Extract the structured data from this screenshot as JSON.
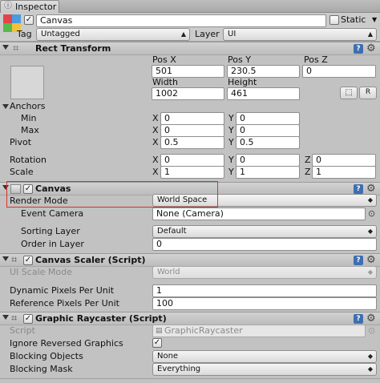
{
  "tab": {
    "label": "Inspector"
  },
  "object": {
    "name": "Canvas",
    "static_label": "Static",
    "tag_label": "Tag",
    "tag_value": "Untagged",
    "layer_label": "Layer",
    "layer_value": "UI"
  },
  "rect_transform": {
    "title": "Rect Transform",
    "pos_x_label": "Pos X",
    "pos_y_label": "Pos Y",
    "pos_z_label": "Pos Z",
    "pos_x": "501",
    "pos_y": "230.5",
    "pos_z": "0",
    "width_label": "Width",
    "height_label": "Height",
    "width": "1002",
    "height": "461",
    "r_label": "R",
    "anchors_label": "Anchors",
    "min_label": "Min",
    "max_label": "Max",
    "anchor_min_x": "0",
    "anchor_min_y": "0",
    "anchor_max_x": "0",
    "anchor_max_y": "0",
    "pivot_label": "Pivot",
    "pivot_x": "0.5",
    "pivot_y": "0.5",
    "rotation_label": "Rotation",
    "rot_x": "0",
    "rot_y": "0",
    "rot_z": "0",
    "scale_label": "Scale",
    "scale_x": "1",
    "scale_y": "1",
    "scale_z": "1",
    "x": "X",
    "y": "Y",
    "z": "Z"
  },
  "canvas": {
    "title": "Canvas",
    "render_mode_label": "Render Mode",
    "render_mode": "World Space",
    "event_camera_label": "Event Camera",
    "event_camera": "None (Camera)",
    "sorting_layer_label": "Sorting Layer",
    "sorting_layer": "Default",
    "order_label": "Order in Layer",
    "order": "0"
  },
  "canvas_scaler": {
    "title": "Canvas Scaler (Script)",
    "ui_scale_label": "UI Scale Mode",
    "ui_scale": "World",
    "dynamic_label": "Dynamic Pixels Per Unit",
    "dynamic": "1",
    "reference_label": "Reference Pixels Per Unit",
    "reference": "100"
  },
  "raycaster": {
    "title": "Graphic Raycaster (Script)",
    "script_label": "Script",
    "script_value": "GraphicRaycaster",
    "ignore_label": "Ignore Reversed Graphics",
    "blocking_objects_label": "Blocking Objects",
    "blocking_objects": "None",
    "blocking_mask_label": "Blocking Mask",
    "blocking_mask": "Everything"
  },
  "glyphs": {
    "check": "✓",
    "help": "?",
    "gear": "⚙",
    "arrow": "▼",
    "dot": "⊙"
  },
  "colors": {
    "highlight": "#d9342b",
    "help": "#3e6fb0"
  }
}
